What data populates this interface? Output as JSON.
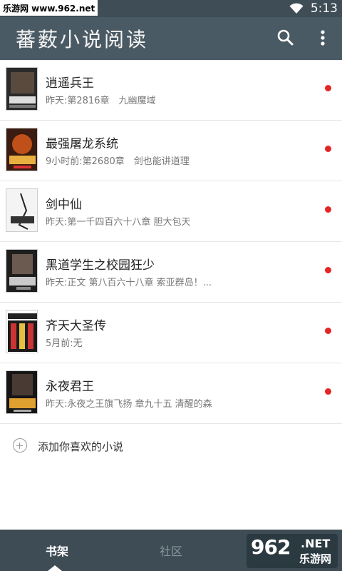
{
  "status_bar": {
    "watermark": "乐游网 www.962.net",
    "time": "5:13"
  },
  "app_bar": {
    "title": "蕃薮小说阅读",
    "icons": [
      "search-icon",
      "more-vert-icon"
    ]
  },
  "books": [
    {
      "title": "逍遥兵王",
      "update": "昨天:第2816章　九幽魔域"
    },
    {
      "title": "最强屠龙系统",
      "update": "9小时前:第2680章　剑也能讲道理"
    },
    {
      "title": "剑中仙",
      "update": "昨天:第一千四百六十八章 胆大包天"
    },
    {
      "title": "黑道学生之校园狂少",
      "update": "昨天:正文 第八百六十八章 索亚群岛！..."
    },
    {
      "title": "齐天大圣传",
      "update": "5月前:无"
    },
    {
      "title": "永夜君王",
      "update": "昨天:永夜之王旗飞扬 章九十五 清醒的森"
    }
  ],
  "add_book": {
    "label": "添加你喜欢的小说"
  },
  "bottom_nav": {
    "tabs": [
      {
        "label": "书架",
        "active": true
      },
      {
        "label": "社区",
        "active": false
      }
    ]
  },
  "watermark_logo": {
    "number": "962",
    "suffix": ".NET",
    "text": "乐游网"
  },
  "colors": {
    "app_bar": "#4a5a64",
    "status_bar": "#3f4d56",
    "bottom_nav": "#3e4c55",
    "unread_dot": "#e52524"
  }
}
